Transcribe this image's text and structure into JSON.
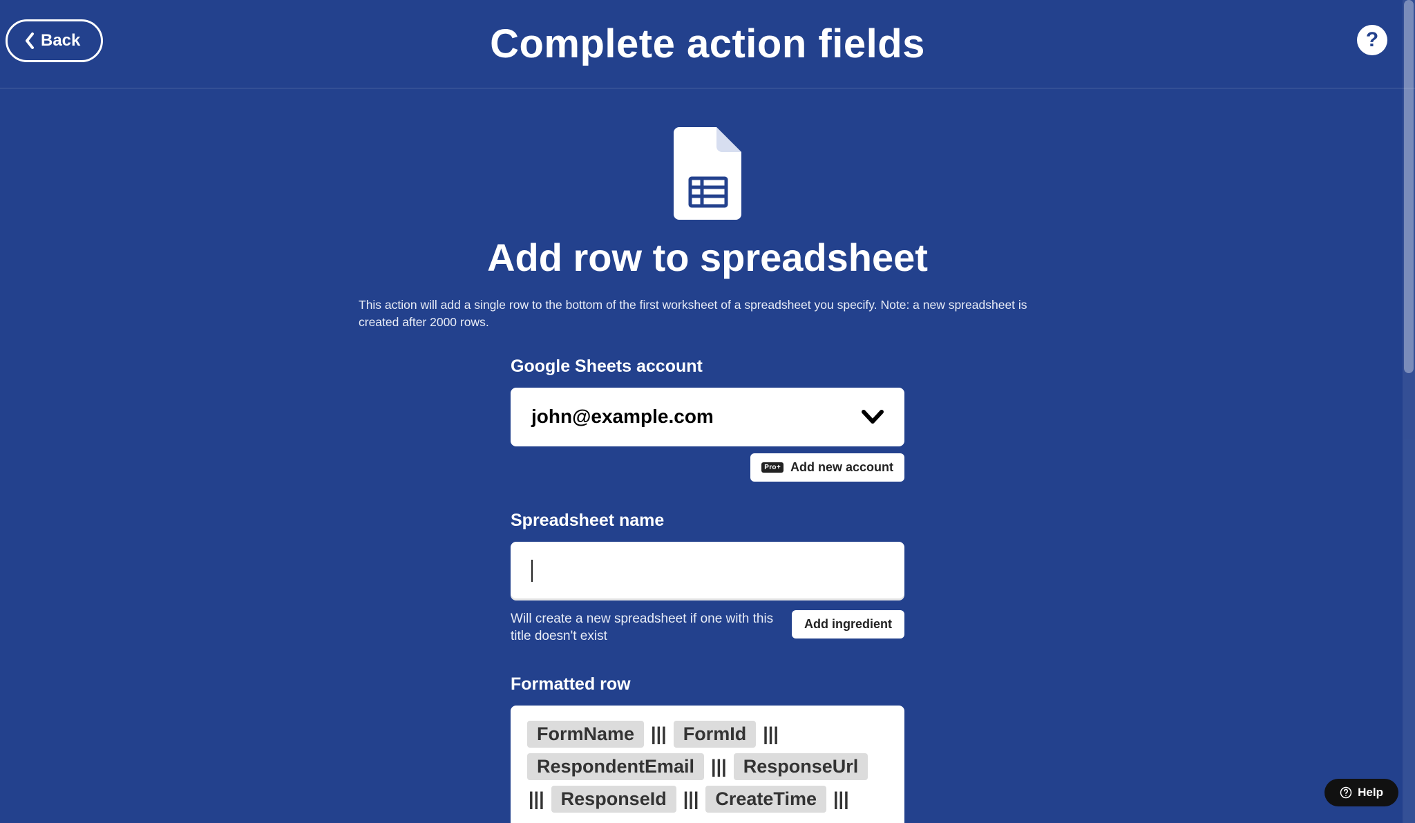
{
  "header": {
    "back_label": "Back",
    "title": "Complete action fields"
  },
  "action": {
    "title": "Add row to spreadsheet",
    "description": "This action will add a single row to the bottom of the first worksheet of a spreadsheet you specify. Note: a new spreadsheet is created after 2000 rows."
  },
  "form": {
    "account_label": "Google Sheets account",
    "account_value": "john@example.com",
    "add_account_badge": "Pro+",
    "add_account_label": "Add new account",
    "spreadsheet_label": "Spreadsheet name",
    "spreadsheet_value": "",
    "spreadsheet_hint": "Will create a new spreadsheet if one with this title doesn't exist",
    "add_ingredient_label": "Add ingredient",
    "formatted_row_label": "Formatted row",
    "formatted_row_tokens": [
      "FormName",
      "FormId",
      "RespondentEmail",
      "ResponseUrl",
      "ResponseId",
      "CreateTime"
    ],
    "token_separator": "|||"
  },
  "help": {
    "badge": "?",
    "pill_label": "Help"
  },
  "icons": {
    "sheets": "google-sheets-icon",
    "chevron_left": "chevron-left-icon",
    "chevron_down": "chevron-down-icon",
    "help_circle": "help-circle-icon"
  },
  "colors": {
    "bg": "#23418d",
    "white": "#ffffff",
    "token_bg": "#dcdcdc",
    "dark": "#111111"
  }
}
